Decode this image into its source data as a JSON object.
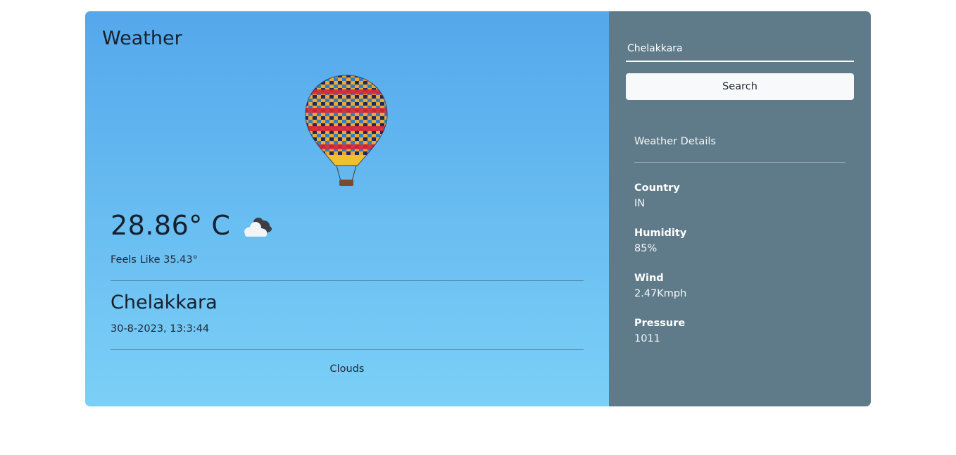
{
  "app": {
    "title": "Weather"
  },
  "current": {
    "temperature": "28.86° C",
    "feels_like": "Feels Like 35.43°",
    "city": "Chelakkara",
    "datetime": "30-8-2023, 13:3:44",
    "condition": "Clouds",
    "condition_icon": "cloud-icon"
  },
  "search": {
    "value": "Chelakkara",
    "button_label": "Search"
  },
  "details": {
    "title": "Weather Details",
    "items": [
      {
        "label": "Country",
        "value": "IN"
      },
      {
        "label": "Humidity",
        "value": "85%"
      },
      {
        "label": "Wind",
        "value": "2.47Kmph"
      },
      {
        "label": "Pressure",
        "value": "1011"
      }
    ]
  },
  "colors": {
    "gradient_top": "#54a8eb",
    "gradient_bottom": "#7bd0f7",
    "sidebar": "#5f7b89"
  }
}
